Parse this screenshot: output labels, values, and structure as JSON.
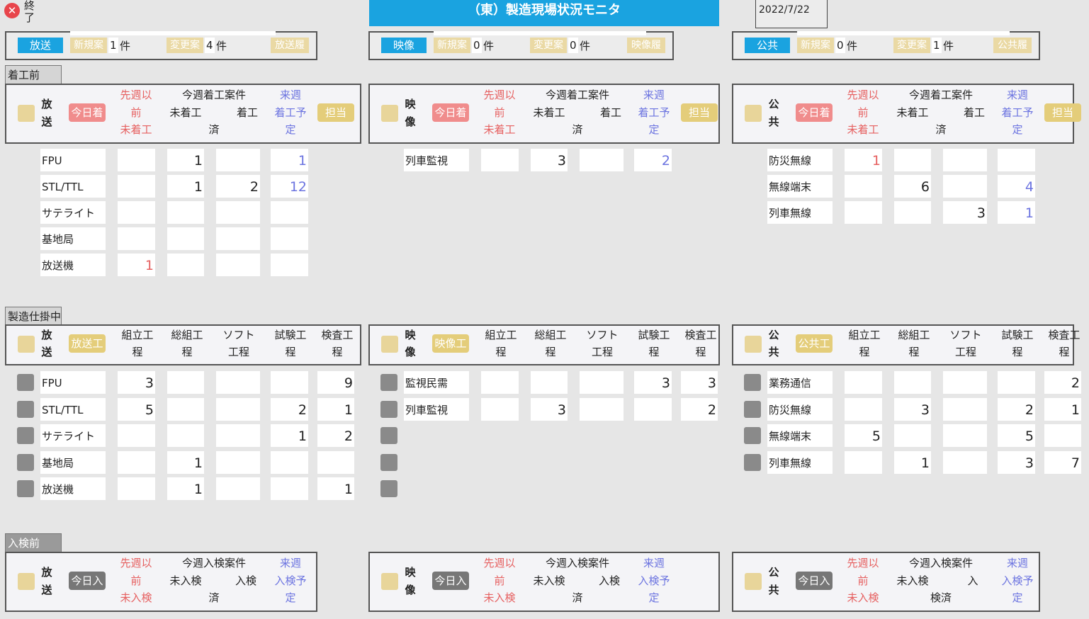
{
  "exit": {
    "label": "終了"
  },
  "title": "（東）製造現場状況モニタ",
  "date": "2022/7/22",
  "summary": [
    {
      "tab": "放送",
      "new_label": "新規案",
      "new_count": "1",
      "change_label": "変更案",
      "change_count": "4",
      "unit": "件",
      "hist": "放送履"
    },
    {
      "tab": "映像",
      "new_label": "新規案",
      "new_count": "0",
      "change_label": "変更案",
      "change_count": "0",
      "unit": "件",
      "hist": "映像履"
    },
    {
      "tab": "公共",
      "new_label": "新規案",
      "new_count": "0",
      "change_label": "変更案",
      "change_count": "1",
      "unit": "件",
      "hist": "公共履"
    }
  ],
  "sections": {
    "pre_start": "着工前",
    "in_progress": "製造仕掛中",
    "pre_inspection": "入検前"
  },
  "groups": [
    {
      "cat1": "放",
      "cat2": "送",
      "start_header": {
        "today": "今日着工",
        "prev1": "先週以",
        "prev2": "前",
        "prev3": "未着工",
        "this": "今週着工案件",
        "notyet": "未着工",
        "done1": "着工",
        "done2": "済",
        "next1": "来週",
        "next2": "着工予",
        "next3": "定",
        "owner": "担当"
      },
      "start_rows": [
        {
          "label": "FPU",
          "prev": "",
          "notyet": "1",
          "done": "",
          "next": "1"
        },
        {
          "label": "STL/TTL",
          "prev": "",
          "notyet": "1",
          "done": "2",
          "next": "12"
        },
        {
          "label": "サテライト",
          "prev": "",
          "notyet": "",
          "done": "",
          "next": ""
        },
        {
          "label": "基地局",
          "prev": "",
          "notyet": "",
          "done": "",
          "next": ""
        },
        {
          "label": "放送機",
          "prev": "1",
          "notyet": "",
          "done": "",
          "next": ""
        }
      ],
      "proc_header": {
        "badge": "放送工程",
        "a1": "組立工",
        "a2": "程",
        "b1": "総組工",
        "b2": "程",
        "c1": "ソフト",
        "c2": "工程",
        "d1": "試験工",
        "d2": "程",
        "e1": "検査工",
        "e2": "程"
      },
      "proc_rows": [
        {
          "label": "FPU",
          "a": "3",
          "b": "",
          "c": "",
          "d": "",
          "e": "9"
        },
        {
          "label": "STL/TTL",
          "a": "5",
          "b": "",
          "c": "",
          "d": "2",
          "e": "1"
        },
        {
          "label": "サテライト",
          "a": "",
          "b": "",
          "c": "",
          "d": "1",
          "e": "2"
        },
        {
          "label": "基地局",
          "a": "",
          "b": "1",
          "c": "",
          "d": "",
          "e": ""
        },
        {
          "label": "放送機",
          "a": "",
          "b": "1",
          "c": "",
          "d": "",
          "e": "1"
        }
      ],
      "insp_header": {
        "today": "今日入検",
        "prev1": "先週以",
        "prev2": "前",
        "prev3": "未入検",
        "this": "今週入検案件",
        "notyet": "未入検",
        "done1": "入検",
        "done2": "済",
        "next1": "来週",
        "next2": "入検予",
        "next3": "定"
      }
    },
    {
      "cat1": "映",
      "cat2": "像",
      "start_header": {
        "today": "今日着工",
        "prev1": "先週以",
        "prev2": "前",
        "prev3": "未着工",
        "this": "今週着工案件",
        "notyet": "未着工",
        "done1": "着工",
        "done2": "済",
        "next1": "来週",
        "next2": "着工予",
        "next3": "定",
        "owner": "担当"
      },
      "start_rows": [
        {
          "label": "列車監視",
          "prev": "",
          "notyet": "3",
          "done": "",
          "next": "2"
        }
      ],
      "proc_header": {
        "badge": "映像工程",
        "a1": "組立工",
        "a2": "程",
        "b1": "総組工",
        "b2": "程",
        "c1": "ソフト",
        "c2": "工程",
        "d1": "試験工",
        "d2": "程",
        "e1": "検査工",
        "e2": "程"
      },
      "proc_rows": [
        {
          "label": "監視民需",
          "a": "",
          "b": "",
          "c": "",
          "d": "3",
          "e": "3"
        },
        {
          "label": "列車監視",
          "a": "",
          "b": "3",
          "c": "",
          "d": "",
          "e": "2"
        }
      ],
      "insp_header": {
        "today": "今日入検",
        "prev1": "先週以",
        "prev2": "前",
        "prev3": "未入検",
        "this": "今週入検案件",
        "notyet": "未入検",
        "done1": "入検",
        "done2": "済",
        "next1": "来週",
        "next2": "入検予",
        "next3": "定"
      }
    },
    {
      "cat1": "公",
      "cat2": "共",
      "start_header": {
        "today": "今日着工",
        "prev1": "先週以",
        "prev2": "前",
        "prev3": "未着工",
        "this": "今週着工案件",
        "notyet": "未着工",
        "done1": "着工",
        "done2": "済",
        "next1": "来週",
        "next2": "着工予",
        "next3": "定",
        "owner": "担当"
      },
      "start_rows": [
        {
          "label": "防災無線",
          "prev": "1",
          "notyet": "",
          "done": "",
          "next": ""
        },
        {
          "label": "無線端末",
          "prev": "",
          "notyet": "6",
          "done": "",
          "next": "4"
        },
        {
          "label": "列車無線",
          "prev": "",
          "notyet": "",
          "done": "3",
          "next": "1"
        }
      ],
      "proc_header": {
        "badge": "公共工程",
        "a1": "組立工",
        "a2": "程",
        "b1": "総組工",
        "b2": "程",
        "c1": "ソフト",
        "c2": "工程",
        "d1": "試験工",
        "d2": "程",
        "e1": "検査工",
        "e2": "程"
      },
      "proc_rows": [
        {
          "label": "業務通信",
          "a": "",
          "b": "",
          "c": "",
          "d": "",
          "e": "2"
        },
        {
          "label": "防災無線",
          "a": "",
          "b": "3",
          "c": "",
          "d": "2",
          "e": "1"
        },
        {
          "label": "無線端末",
          "a": "5",
          "b": "",
          "c": "",
          "d": "5",
          "e": ""
        },
        {
          "label": "列車無線",
          "a": "",
          "b": "1",
          "c": "",
          "d": "3",
          "e": "7"
        }
      ],
      "insp_header": {
        "today": "今日入検",
        "prev1": "先週以",
        "prev2": "前",
        "prev3": "未入検",
        "this": "今週入検案件",
        "notyet": "未入検",
        "done1": "入",
        "done2": "検済",
        "next1": "来週",
        "next2": "入検予",
        "next3": "定"
      }
    }
  ]
}
